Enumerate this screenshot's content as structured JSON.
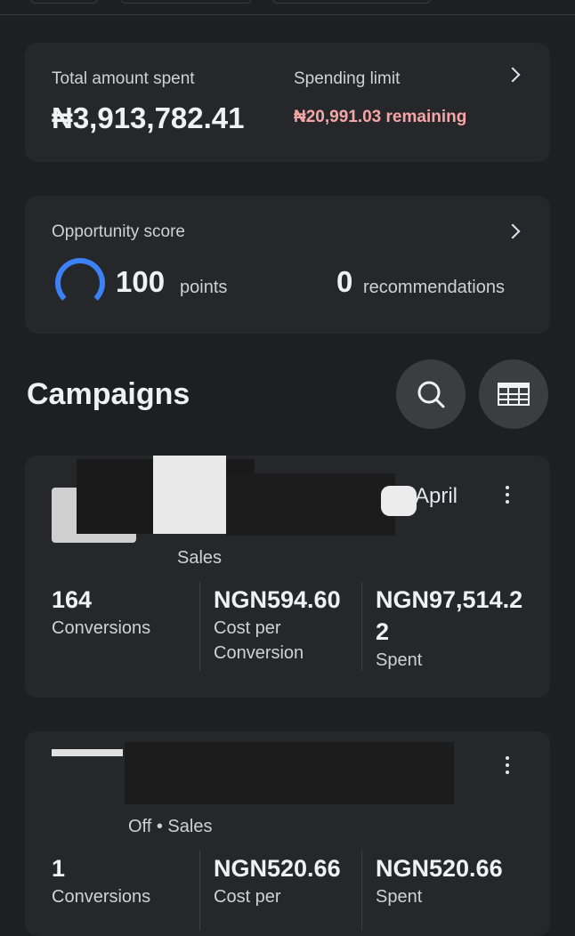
{
  "summary": {
    "total_label": "Total amount spent",
    "total_value": "₦3,913,782.41",
    "limit_label": "Spending limit",
    "limit_value": "₦20,991.03 remaining"
  },
  "opportunity": {
    "label": "Opportunity score",
    "points_value": "100",
    "points_unit": "points",
    "recs_value": "0",
    "recs_unit": "recommendations"
  },
  "campaigns": {
    "title": "Campaigns",
    "items": [
      {
        "date_fragment": "April",
        "status_line": "Sales",
        "metrics": [
          {
            "value": "164",
            "label": "Conversions"
          },
          {
            "value": "NGN594.60",
            "label": "Cost per Conversion"
          },
          {
            "value": "NGN97,514.22",
            "label": "Spent"
          }
        ]
      },
      {
        "status_line": "Off • Sales",
        "metrics": [
          {
            "value": "1",
            "label": "Conversions"
          },
          {
            "value": "NGN520.66",
            "label": "Cost per"
          },
          {
            "value": "NGN520.66",
            "label": "Spent"
          }
        ]
      }
    ]
  },
  "icons": [
    "chevron-right-icon",
    "progress-ring-icon",
    "search-icon",
    "table-icon",
    "more-options-icon"
  ],
  "colors": {
    "background": "#1e1f21",
    "card": "#26272a",
    "accent_blue": "#3b82f6",
    "warning_pink": "#f5a6a6"
  }
}
